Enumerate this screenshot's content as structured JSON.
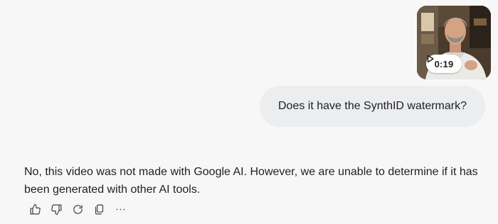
{
  "video": {
    "duration": "0:19",
    "icon": "play-icon"
  },
  "user_message": {
    "text": "Does it have the SynthID watermark?"
  },
  "response": {
    "text": "No, this video was not made with Google AI. However, we are unable to determine if it has been generated with other AI tools."
  },
  "actions": [
    {
      "icon": "thumb-up-icon"
    },
    {
      "icon": "thumb-down-icon"
    },
    {
      "icon": "redo-icon"
    },
    {
      "icon": "copy-icon"
    },
    {
      "icon": "more-options-icon"
    }
  ]
}
